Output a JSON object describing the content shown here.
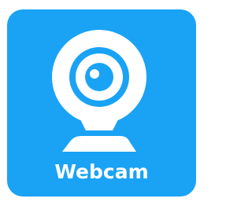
{
  "app": {
    "label": "Webcam",
    "icon": "webcam-icon"
  },
  "colors": {
    "tile_background": "#1aa3f5",
    "icon_foreground": "#ffffff",
    "lens_iris": "#1aa3f5",
    "lens_pupil": "#ffffff"
  }
}
